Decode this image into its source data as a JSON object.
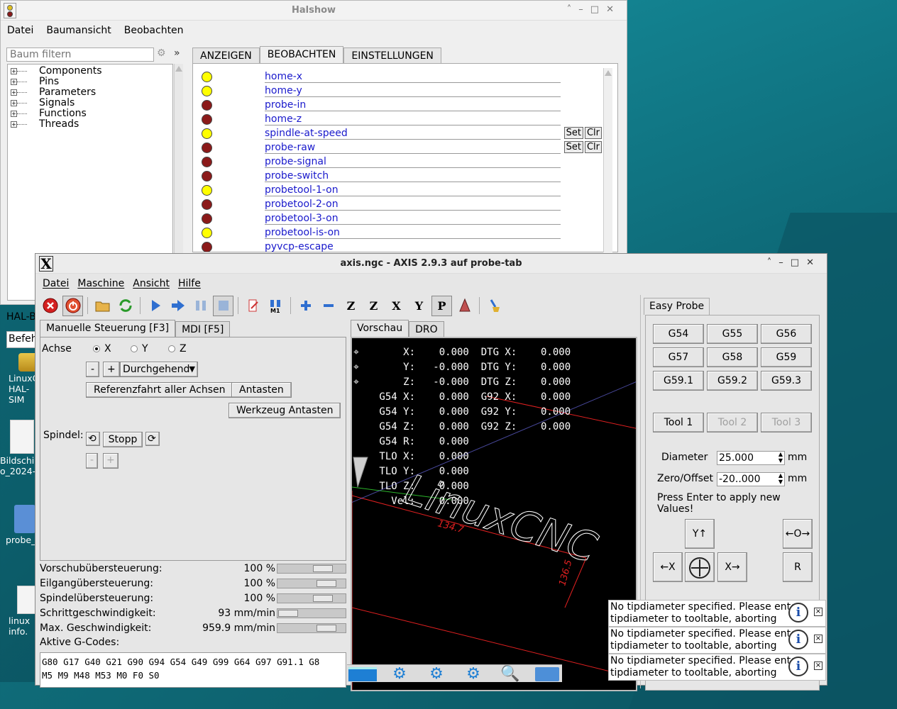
{
  "desktop": {
    "icons": [
      {
        "label": "LinuxC HAL-SIM"
      },
      {
        "label": "Bildschi o_2024-"
      },
      {
        "label": "probe_"
      },
      {
        "label": "linux info."
      }
    ]
  },
  "halshow": {
    "title": "Halshow",
    "menu": [
      "Datei",
      "Baumansicht",
      "Beobachten"
    ],
    "filter_placeholder": "Baum filtern",
    "chevron": "»",
    "tree": [
      "Components",
      "Pins",
      "Parameters",
      "Signals",
      "Functions",
      "Threads"
    ],
    "tabs": [
      "ANZEIGEN",
      "BEOBACHTEN",
      "EINSTELLUNGEN"
    ],
    "set_label": "Set",
    "clr_label": "Clr",
    "colors": {
      "led_on": "#ffff00",
      "led_off": "#8b1a1a"
    },
    "watch": [
      {
        "name": "home-x",
        "state": "on",
        "settable": false
      },
      {
        "name": "home-y",
        "state": "on",
        "settable": false
      },
      {
        "name": "probe-in",
        "state": "off",
        "settable": false
      },
      {
        "name": "home-z",
        "state": "off",
        "settable": false
      },
      {
        "name": "spindle-at-speed",
        "state": "on",
        "settable": true
      },
      {
        "name": "probe-raw",
        "state": "off",
        "settable": true
      },
      {
        "name": "probe-signal",
        "state": "off",
        "settable": false
      },
      {
        "name": "probe-switch",
        "state": "off",
        "settable": false
      },
      {
        "name": "probetool-1-on",
        "state": "on",
        "settable": false
      },
      {
        "name": "probetool-2-on",
        "state": "off",
        "settable": false
      },
      {
        "name": "probetool-3-on",
        "state": "off",
        "settable": false
      },
      {
        "name": "probetool-is-on",
        "state": "on",
        "settable": false
      },
      {
        "name": "pyvcp-escape",
        "state": "off",
        "settable": false
      }
    ],
    "bottom_label": "HAL-B",
    "command_label": "Befeh"
  },
  "axis": {
    "title": "axis.ngc - AXIS 2.9.3 auf probe-tab",
    "menu": [
      "Datei",
      "Maschine",
      "Ansicht",
      "Hilfe"
    ],
    "tabs": [
      "Manuelle Steuerung [F3]",
      "MDI [F5]"
    ],
    "manual": {
      "axis_label": "Achse",
      "axes": [
        "X",
        "Y",
        "Z"
      ],
      "minus": "-",
      "plus": "+",
      "jog_mode": "Durchgehend",
      "home_all": "Referenzfahrt aller Achsen",
      "touch_off": "Antasten",
      "tool_touch_off": "Werkzeug Antasten",
      "spindle_label": "Spindel:",
      "spindle_stop": "Stopp"
    },
    "sliders": [
      {
        "label": "Vorschubübersteuerung:",
        "value": "100 %",
        "level": 0.8
      },
      {
        "label": "Eilgangübersteuerung:",
        "value": "100 %",
        "level": 0.85
      },
      {
        "label": "Spindelübersteuerung:",
        "value": "100 %",
        "level": 0.8
      },
      {
        "label": "Schrittgeschwindigkeit:",
        "value": "93 mm/min",
        "level": 0.3
      },
      {
        "label": "Max. Geschwindigkeit:",
        "value": "959.9 mm/min",
        "level": 0.85
      }
    ],
    "active_gcodes_label": "Aktive G-Codes:",
    "gcodes_line1": "G80 G17 G40 G21 G90 G94 G54 G49 G99 G64 G97 G91.1 G8",
    "gcodes_line2": "M5 M9 M48 M53 M0 F0 S0",
    "preview_tabs": [
      "Vorschau",
      "DRO"
    ],
    "dro_lines": [
      "     X:    0.000  DTG X:    0.000",
      "     Y:   -0.000  DTG Y:    0.000",
      "     Z:   -0.000  DTG Z:    0.000",
      " G54 X:    0.000  G92 X:    0.000",
      " G54 Y:    0.000  G92 Y:    0.000",
      " G54 Z:    0.000  G92 Z:    0.000",
      " G54 R:    0.000",
      " TLO X:    0.000",
      " TLO Y:    0.000",
      " TLO Z:    0.000",
      "   Vel:    0.000"
    ],
    "dim1": "134.7",
    "dim2": "136.5",
    "logo_text": "LinuxCNC",
    "probe": {
      "tab": "Easy Probe",
      "g_buttons": [
        "G54",
        "G55",
        "G56",
        "G57",
        "G58",
        "G59",
        "G59.1",
        "G59.2",
        "G59.3"
      ],
      "tools": [
        "Tool 1",
        "Tool 2",
        "Tool 3"
      ],
      "diameter_label": "Diameter",
      "diameter_value": "25.000",
      "offset_label": "Zero/Offset",
      "offset_value": "-20..000",
      "unit": "mm",
      "hint": "Press Enter to apply new Values!",
      "jog_labels": [
        "Y↑",
        "←O→",
        "←X",
        "X→",
        "R"
      ]
    }
  },
  "notifications": [
    {
      "text1": "No tipdiameter specified. Please enter",
      "text2": "tipdiameter to tooltable, aborting"
    },
    {
      "text1": "No tipdiameter specified. Please enter",
      "text2": "tipdiameter to tooltable, aborting"
    },
    {
      "text1": "No tipdiameter specified. Please enter",
      "text2": "tipdiameter to tooltable, aborting"
    }
  ],
  "info_glyph": "i",
  "close_glyph": "×"
}
